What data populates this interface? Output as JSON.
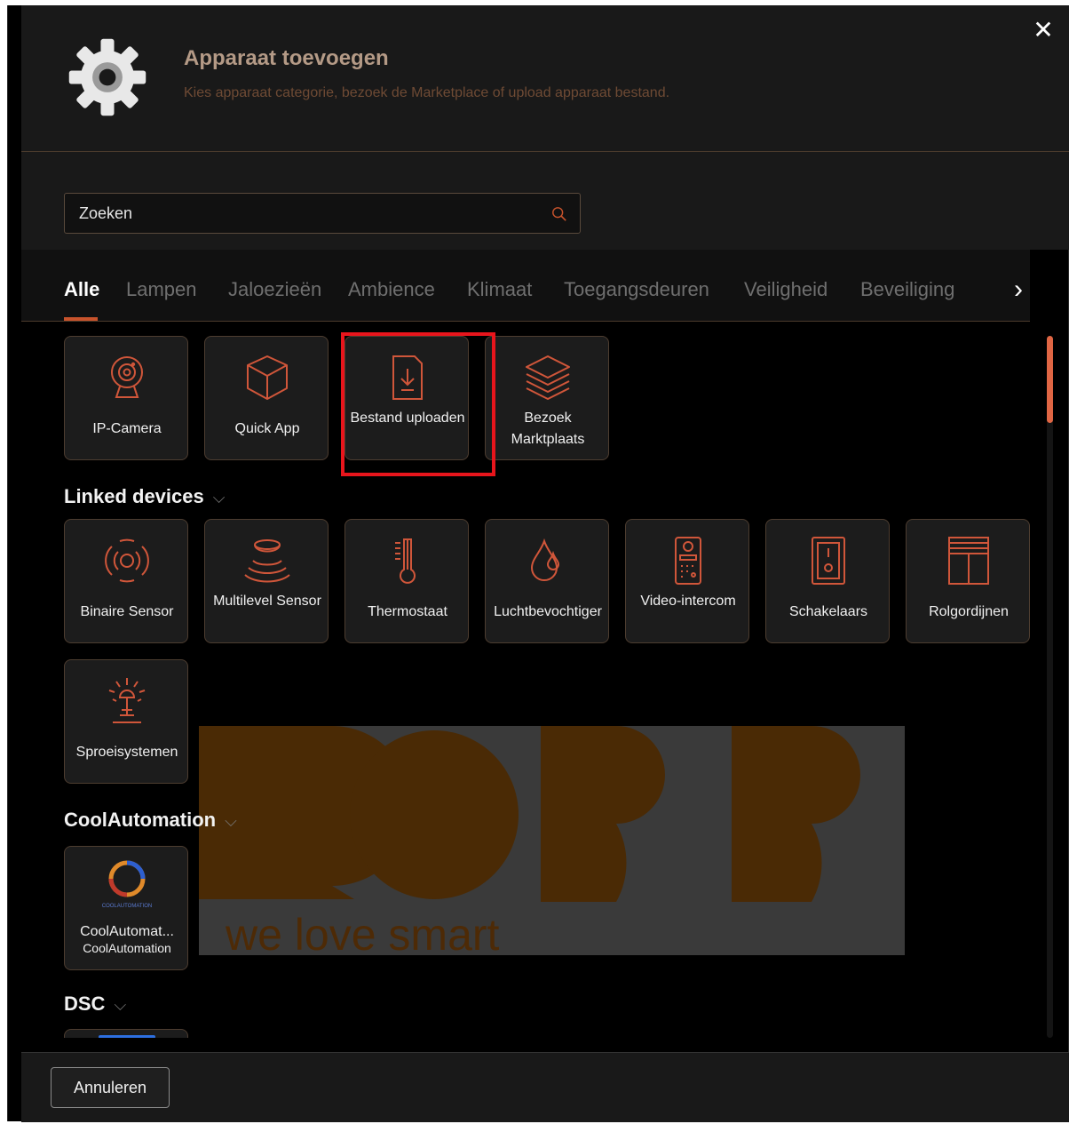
{
  "dialog": {
    "title": "Apparaat toevoegen",
    "subtitle": "Kies apparaat categorie, bezoek de Marketplace of upload apparaat bestand.",
    "close_icon": "close-icon",
    "header_icon": "gear-icon"
  },
  "search": {
    "placeholder": "Zoeken"
  },
  "tabs": [
    {
      "label": "Alle",
      "active": true
    },
    {
      "label": "Lampen"
    },
    {
      "label": "Jaloezieën"
    },
    {
      "label": "Ambience"
    },
    {
      "label": "Klimaat"
    },
    {
      "label": "Toegangsdeuren"
    },
    {
      "label": "Veiligheid"
    },
    {
      "label": "Beveiliging"
    }
  ],
  "top_tiles": [
    {
      "label": "IP-Camera",
      "icon": "camera-icon"
    },
    {
      "label": "Quick App",
      "icon": "cube-icon"
    },
    {
      "label": "Bestand uploaden",
      "icon": "file-upload-icon",
      "highlighted": true
    },
    {
      "label": "Bezoek Marktplaats",
      "icon": "layers-icon"
    }
  ],
  "sections": [
    {
      "title": "Linked devices",
      "tiles": [
        {
          "label": "Binaire Sensor",
          "icon": "sensor-waves-icon"
        },
        {
          "label": "Multilevel Sensor",
          "icon": "multilevel-sensor-icon"
        },
        {
          "label": "Thermostaat",
          "icon": "thermometer-icon"
        },
        {
          "label": "Luchtbevochtiger",
          "icon": "droplet-icon"
        },
        {
          "label": "Video-intercom",
          "icon": "intercom-icon"
        },
        {
          "label": "Schakelaars",
          "icon": "switch-icon"
        },
        {
          "label": "Rolgordijnen",
          "icon": "blinds-icon"
        },
        {
          "label": "Sproeisystemen",
          "icon": "sprinkler-icon"
        }
      ]
    },
    {
      "title": "CoolAutomation",
      "tiles": [
        {
          "label": "CoolAutomat...",
          "sublabel": "CoolAutomation",
          "logo_text": "COOLAUTOMATION",
          "icon": "coolautomation-logo"
        }
      ]
    },
    {
      "title": "DSC",
      "tiles": []
    }
  ],
  "watermark": {
    "text": "we love smart",
    "logo": "ROBB"
  },
  "footer": {
    "cancel_label": "Annuleren"
  },
  "colors": {
    "accent": "#c8532c",
    "highlight": "#e8151c",
    "tile_bg": "#1c1c1c",
    "title": "#b49a86"
  }
}
